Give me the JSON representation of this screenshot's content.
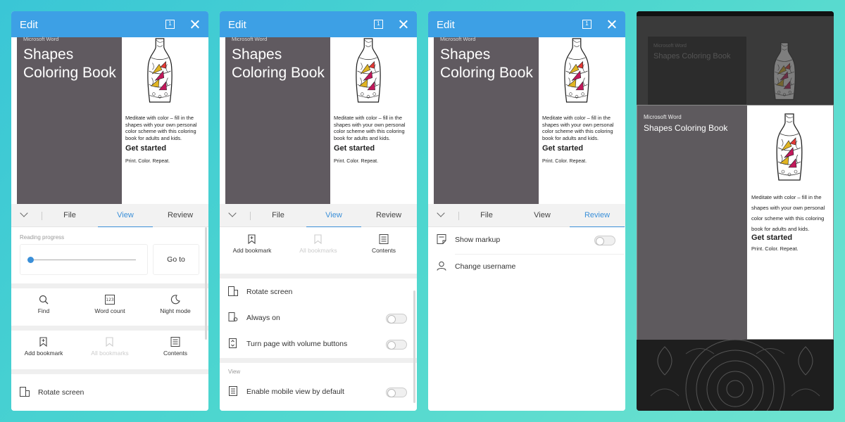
{
  "common": {
    "edit_title": "Edit",
    "page_icon_digit": "1",
    "doc": {
      "brand": "Microsoft Word",
      "title_line1": "Shapes",
      "title_line2": "Coloring Book",
      "description": "Meditate with color – fill in the shapes with your own personal color scheme with this coloring book for adults and kids.",
      "get_started": "Get started",
      "tagline": "Print. Color. Repeat."
    },
    "tabs": [
      "File",
      "View",
      "Review"
    ]
  },
  "screen1": {
    "active_tab": "View",
    "reading_progress_label": "Reading progress",
    "reading_progress_value": 0,
    "goto_label": "Go to",
    "tools": [
      "Find",
      "Word count",
      "Night mode"
    ],
    "bookmarks": [
      "Add bookmark",
      "All bookmarks",
      "Contents"
    ],
    "rotate_label": "Rotate screen"
  },
  "screen2": {
    "active_tab": "View",
    "bookmarks": [
      "Add bookmark",
      "All bookmarks",
      "Contents"
    ],
    "rows": [
      "Rotate screen",
      "Always on",
      "Turn page with volume buttons"
    ],
    "view_section_label": "View",
    "mobile_view_label": "Enable mobile view by default"
  },
  "screen3": {
    "active_tab": "Review",
    "show_markup_label": "Show markup",
    "change_username_label": "Change username"
  },
  "screen4": {
    "brand": "Microsoft Word",
    "title": "Shapes Coloring Book",
    "description": "Meditate with color – fill in the shapes with your own personal color scheme with this coloring book for adults and kids.",
    "get_started": "Get started",
    "tagline": "Print. Color. Repeat."
  },
  "colors": {
    "accent": "#3da0e5",
    "active_tab": "#3a8fd8",
    "cover": "#605a60",
    "background_start": "#3ac6d6",
    "background_end": "#6fe3cf"
  },
  "icons": {
    "close": "close-icon",
    "page": "page-number-icon",
    "collapse": "chevron-down-icon",
    "find": "search-icon",
    "word_count": "word-count-icon",
    "night_mode": "moon-icon",
    "add_bookmark": "bookmark-add-icon",
    "all_bookmarks": "bookmarks-icon",
    "contents": "contents-icon",
    "rotate": "rotate-screen-icon",
    "always_on": "brightness-icon",
    "volume": "volume-buttons-icon",
    "mobile_view": "mobile-view-icon",
    "markup": "markup-icon",
    "user": "user-icon"
  }
}
